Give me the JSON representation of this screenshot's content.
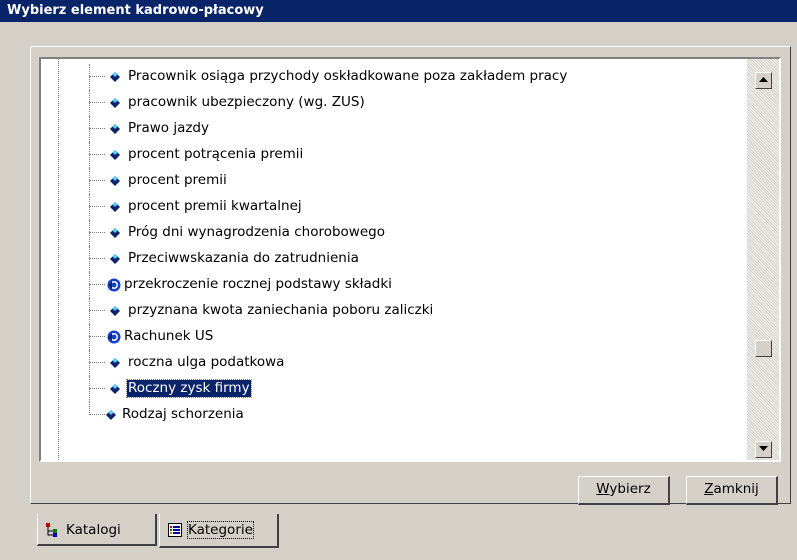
{
  "window": {
    "title": "Wybierz element kadrowo-płacowy"
  },
  "tree": {
    "items": [
      {
        "label": "Pracownik osiąga przychody oskładkowane poza zakładem pracy",
        "icon": "diamond-icon"
      },
      {
        "label": "pracownik ubezpieczony (wg. ZUS)",
        "icon": "diamond-icon"
      },
      {
        "label": "Prawo jazdy",
        "icon": "diamond-icon"
      },
      {
        "label": "procent potrącenia premii",
        "icon": "diamond-icon"
      },
      {
        "label": "procent premii",
        "icon": "diamond-icon"
      },
      {
        "label": "procent premii kwartalnej",
        "icon": "diamond-icon"
      },
      {
        "label": "Próg dni wynagrodzenia chorobowego",
        "icon": "diamond-icon"
      },
      {
        "label": "Przeciwwskazania do zatrudnienia",
        "icon": "diamond-icon"
      },
      {
        "label": "przekroczenie rocznej podstawy składki",
        "icon": "globe-diamond-icon"
      },
      {
        "label": "przyznana kwota zaniechania poboru zaliczki",
        "icon": "diamond-icon"
      },
      {
        "label": "Rachunek US",
        "icon": "globe-diamond-icon"
      },
      {
        "label": "roczna ulga podatkowa",
        "icon": "diamond-icon"
      },
      {
        "label": "Roczny zysk firmy",
        "icon": "diamond-icon",
        "selected": true
      },
      {
        "label": "Rodzaj schorzenia",
        "icon": "diamond-icon"
      }
    ]
  },
  "buttons": {
    "select_rest": "ybierz",
    "select_access": "W",
    "close_rest": "amknij",
    "close_access": "Z"
  },
  "tabs": [
    {
      "label": "Katalogi",
      "icon": "tree-icon"
    },
    {
      "label": "Kategorie",
      "icon": "list-icon",
      "active": true
    }
  ],
  "colors": {
    "title_bar": "#0a246a",
    "face": "#d4d0c8",
    "selection": "#0a246a",
    "diamond": "#0a246a",
    "globe": "#1040d0"
  }
}
